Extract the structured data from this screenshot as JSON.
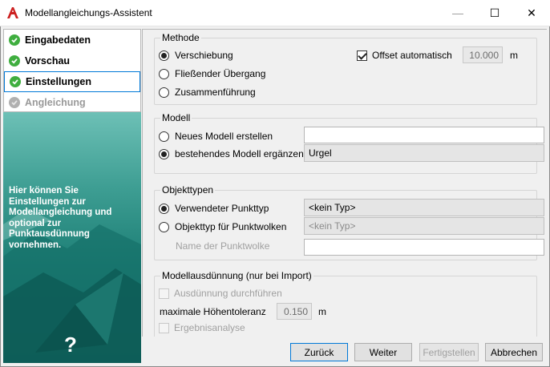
{
  "window": {
    "title": "Modellangleichungs-Assistent",
    "accent": "#cc1f1f",
    "controls": {
      "minimize": "—",
      "maximize": "☐",
      "close": "✕"
    }
  },
  "steps": [
    {
      "label": "Eingabedaten",
      "status": "done"
    },
    {
      "label": "Vorschau",
      "status": "done"
    },
    {
      "label": "Einstellungen",
      "status": "current"
    },
    {
      "label": "Angleichung",
      "status": "pending"
    }
  ],
  "side_panel": {
    "text": "Hier können Sie Einstellungen zur Modellangleichung und optional zur Punktausdünnung vornehmen.",
    "help": "?"
  },
  "methode": {
    "legend": "Methode",
    "options": [
      "Verschiebung",
      "Fließender Übergang",
      "Zusammenführung"
    ],
    "selected": "Verschiebung",
    "offset_checkbox": "Offset automatisch",
    "offset_checked": true,
    "offset_value": "10.000",
    "offset_unit": "m"
  },
  "modell": {
    "legend": "Modell",
    "option_new": "Neues Modell erstellen",
    "option_existing": "bestehendes Modell ergänzen",
    "selected": "bestehendes Modell ergänzen",
    "new_model_value": "",
    "existing_model_value": "Urgel"
  },
  "objekttypen": {
    "legend": "Objekttypen",
    "option_point": "Verwendeter Punkttyp",
    "option_cloud": "Objekttyp für Punktwolken",
    "selected": "Verwendeter Punkttyp",
    "point_type_value": "<kein Typ>",
    "cloud_type_value": "<kein Typ>",
    "cloud_name_label": "Name der Punktwolke",
    "cloud_name_value": ""
  },
  "ausduennung": {
    "legend": "Modellausdünnung (nur bei Import)",
    "thin_checkbox": "Ausdünnung durchführen",
    "tolerance_label": "maximale Höhentoleranz",
    "tolerance_value": "0.150",
    "tolerance_unit": "m",
    "analysis_checkbox": "Ergebnisanalyse"
  },
  "buttons": {
    "back": "Zurück",
    "next": "Weiter",
    "finish": "Fertigstellen",
    "cancel": "Abbrechen"
  }
}
